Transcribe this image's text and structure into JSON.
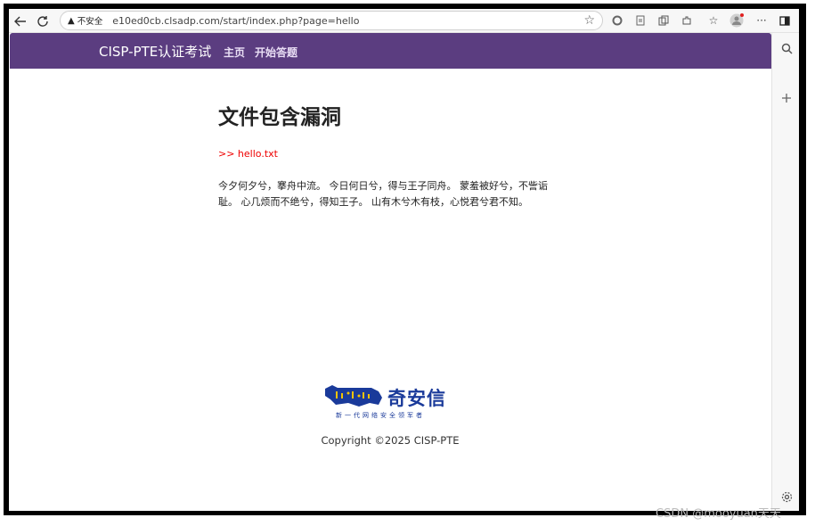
{
  "browser": {
    "security_label": "不安全",
    "url": "e10ed0cb.clsadp.com/start/index.php?page=hello"
  },
  "site": {
    "brand": "CISP-PTE认证考试",
    "nav": [
      {
        "label": "主页"
      },
      {
        "label": "开始答题"
      }
    ]
  },
  "main": {
    "title": "文件包含漏洞",
    "included_file": ">> hello.txt",
    "poem": "今夕何夕兮，搴舟中流。 今日何日兮，得与王子同舟。 蒙羞被好兮，不訾诟耻。 心几烦而不绝兮，得知王子。 山有木兮木有枝，心悦君兮君不知。"
  },
  "footer": {
    "logo_name": "奇安信",
    "logo_slogan": "新一代网络安全领军者",
    "copyright": "Copyright ©2025 CISP-PTE"
  },
  "watermark": "CSDN @mooyuan天天",
  "colors": {
    "navbar": "#5b3d80",
    "included_text": "#e00000",
    "logo": "#1a3a9a",
    "logo_accent": "#f5c400"
  }
}
